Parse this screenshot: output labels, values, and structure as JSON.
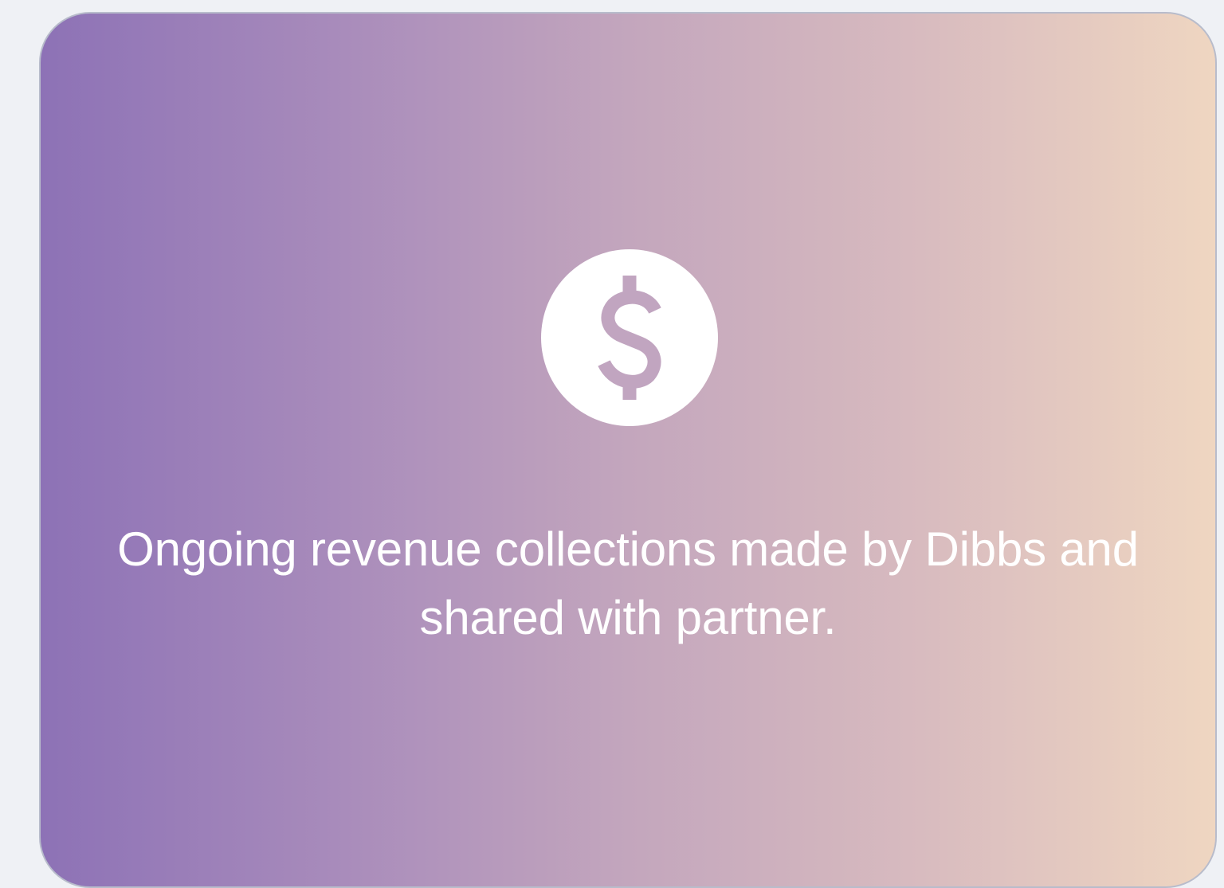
{
  "card": {
    "icon": "dollar-coin-icon",
    "description": "Ongoing revenue collections made by Dibbs and shared with partner.",
    "gradient_colors": [
      "#8d72b6",
      "#c3a6bd",
      "#efd6c1"
    ]
  }
}
